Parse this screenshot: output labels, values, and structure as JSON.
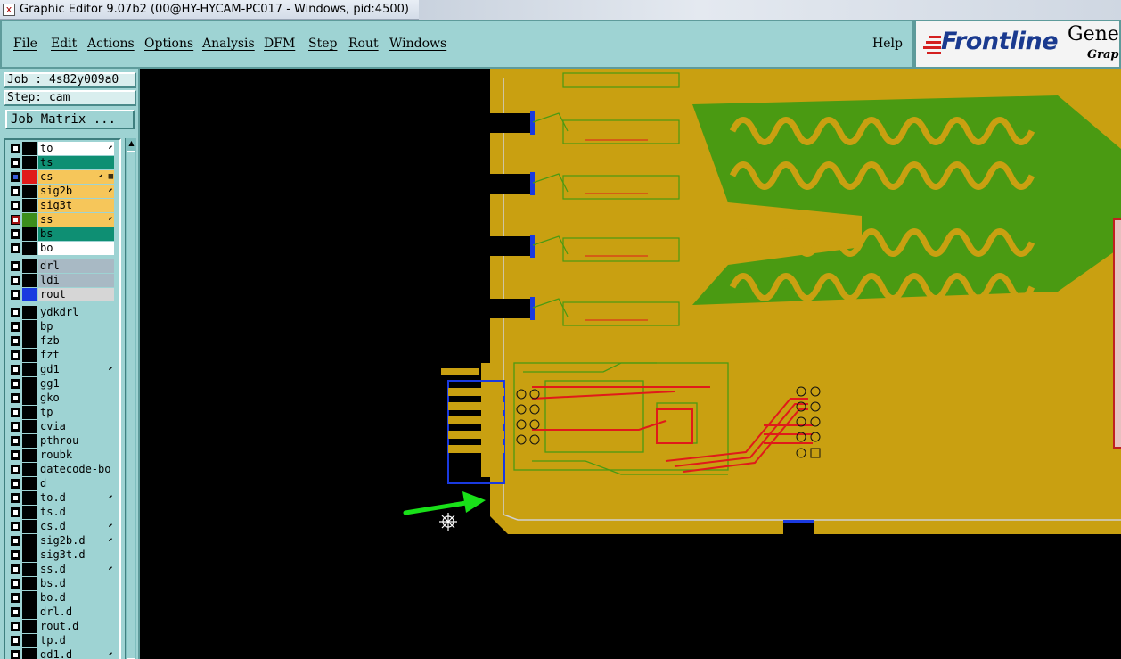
{
  "window": {
    "title": "Graphic Editor 9.07b2 (00@HY-HYCAM-PC017 - Windows, pid:4500)",
    "app_icon": "x-window-icon"
  },
  "menu": {
    "items": [
      "File",
      "Edit",
      "Actions",
      "Options",
      "Analysis",
      "DFM",
      "Step",
      "Rout",
      "Windows"
    ],
    "help": "Help"
  },
  "logo": {
    "brand": "Frontline",
    "product": "Genes",
    "subtitle": "Graph",
    "accent": "#d42020",
    "brand_color": "#1a3a8f"
  },
  "job": {
    "job_label": "Job : 4s82y009a0",
    "step_label": "Step: cam",
    "matrix_button": "Job Matrix ..."
  },
  "layers": [
    {
      "name": "to",
      "color": "#ffffff",
      "swatch": "#000000",
      "flag": "⬋",
      "selected": false
    },
    {
      "name": "ts",
      "color": "#0e8f73",
      "swatch": "#000000",
      "flag": "",
      "selected": false
    },
    {
      "name": "cs",
      "color": "#f6c65a",
      "swatch": "#e01a1a",
      "flag": "⬋ ▦",
      "selected": true
    },
    {
      "name": "sig2b",
      "color": "#f6c65a",
      "swatch": "#000000",
      "flag": "⬋",
      "selected": false
    },
    {
      "name": "sig3t",
      "color": "#f6c65a",
      "swatch": "#000000",
      "flag": "",
      "selected": false
    },
    {
      "name": "ss",
      "color": "#f6c65a",
      "swatch": "#3c8e1c",
      "flag": "⬋",
      "selected": false,
      "chk_red": true
    },
    {
      "name": "bs",
      "color": "#0e8f73",
      "swatch": "#000000",
      "flag": "",
      "selected": false
    },
    {
      "name": "bo",
      "color": "#ffffff",
      "swatch": "#000000",
      "flag": "",
      "selected": false
    },
    {
      "name": "drl",
      "color": "#a8b9c4",
      "swatch": "#000000",
      "flag": "",
      "selected": false,
      "gap": true
    },
    {
      "name": "ldi",
      "color": "#a8b9c4",
      "swatch": "#000000",
      "flag": "",
      "selected": false
    },
    {
      "name": "rout",
      "color": "#d6d6d6",
      "swatch": "#1a3ae0",
      "flag": "",
      "selected": false
    },
    {
      "name": "ydkdrl",
      "color": "#9ed3d3",
      "swatch": "#000000",
      "flag": "",
      "selected": false,
      "gap": true
    },
    {
      "name": "bp",
      "color": "#9ed3d3",
      "swatch": "#000000",
      "flag": "",
      "selected": false
    },
    {
      "name": "fzb",
      "color": "#9ed3d3",
      "swatch": "#000000",
      "flag": "",
      "selected": false
    },
    {
      "name": "fzt",
      "color": "#9ed3d3",
      "swatch": "#000000",
      "flag": "",
      "selected": false
    },
    {
      "name": "gd1",
      "color": "#9ed3d3",
      "swatch": "#000000",
      "flag": "⬋",
      "selected": false
    },
    {
      "name": "gg1",
      "color": "#9ed3d3",
      "swatch": "#000000",
      "flag": "",
      "selected": false
    },
    {
      "name": "gko",
      "color": "#9ed3d3",
      "swatch": "#000000",
      "flag": "",
      "selected": false
    },
    {
      "name": "tp",
      "color": "#9ed3d3",
      "swatch": "#000000",
      "flag": "",
      "selected": false
    },
    {
      "name": "cvia",
      "color": "#9ed3d3",
      "swatch": "#000000",
      "flag": "",
      "selected": false
    },
    {
      "name": "pthrou",
      "color": "#9ed3d3",
      "swatch": "#000000",
      "flag": "",
      "selected": false
    },
    {
      "name": "roubk",
      "color": "#9ed3d3",
      "swatch": "#000000",
      "flag": "",
      "selected": false
    },
    {
      "name": "datecode-bo",
      "color": "#9ed3d3",
      "swatch": "#000000",
      "flag": "",
      "selected": false
    },
    {
      "name": "d",
      "color": "#9ed3d3",
      "swatch": "#000000",
      "flag": "",
      "selected": false
    },
    {
      "name": "to.d",
      "color": "#9ed3d3",
      "swatch": "#000000",
      "flag": "⬋",
      "selected": false
    },
    {
      "name": "ts.d",
      "color": "#9ed3d3",
      "swatch": "#000000",
      "flag": "",
      "selected": false
    },
    {
      "name": "cs.d",
      "color": "#9ed3d3",
      "swatch": "#000000",
      "flag": "⬋",
      "selected": false
    },
    {
      "name": "sig2b.d",
      "color": "#9ed3d3",
      "swatch": "#000000",
      "flag": "⬋",
      "selected": false
    },
    {
      "name": "sig3t.d",
      "color": "#9ed3d3",
      "swatch": "#000000",
      "flag": "",
      "selected": false
    },
    {
      "name": "ss.d",
      "color": "#9ed3d3",
      "swatch": "#000000",
      "flag": "⬋",
      "selected": false
    },
    {
      "name": "bs.d",
      "color": "#9ed3d3",
      "swatch": "#000000",
      "flag": "",
      "selected": false
    },
    {
      "name": "bo.d",
      "color": "#9ed3d3",
      "swatch": "#000000",
      "flag": "",
      "selected": false
    },
    {
      "name": "drl.d",
      "color": "#9ed3d3",
      "swatch": "#000000",
      "flag": "",
      "selected": false
    },
    {
      "name": "rout.d",
      "color": "#9ed3d3",
      "swatch": "#000000",
      "flag": "",
      "selected": false
    },
    {
      "name": "tp.d",
      "color": "#9ed3d3",
      "swatch": "#000000",
      "flag": "",
      "selected": false
    },
    {
      "name": "gd1.d",
      "color": "#9ed3d3",
      "swatch": "#000000",
      "flag": "⬋",
      "selected": false
    }
  ],
  "canvas": {
    "board_color": "#c9a011",
    "copper_color": "#4a9a12",
    "trace_color": "#e01a1a",
    "rout_color": "#1a3ae0",
    "annotation_color": "#19e019"
  }
}
